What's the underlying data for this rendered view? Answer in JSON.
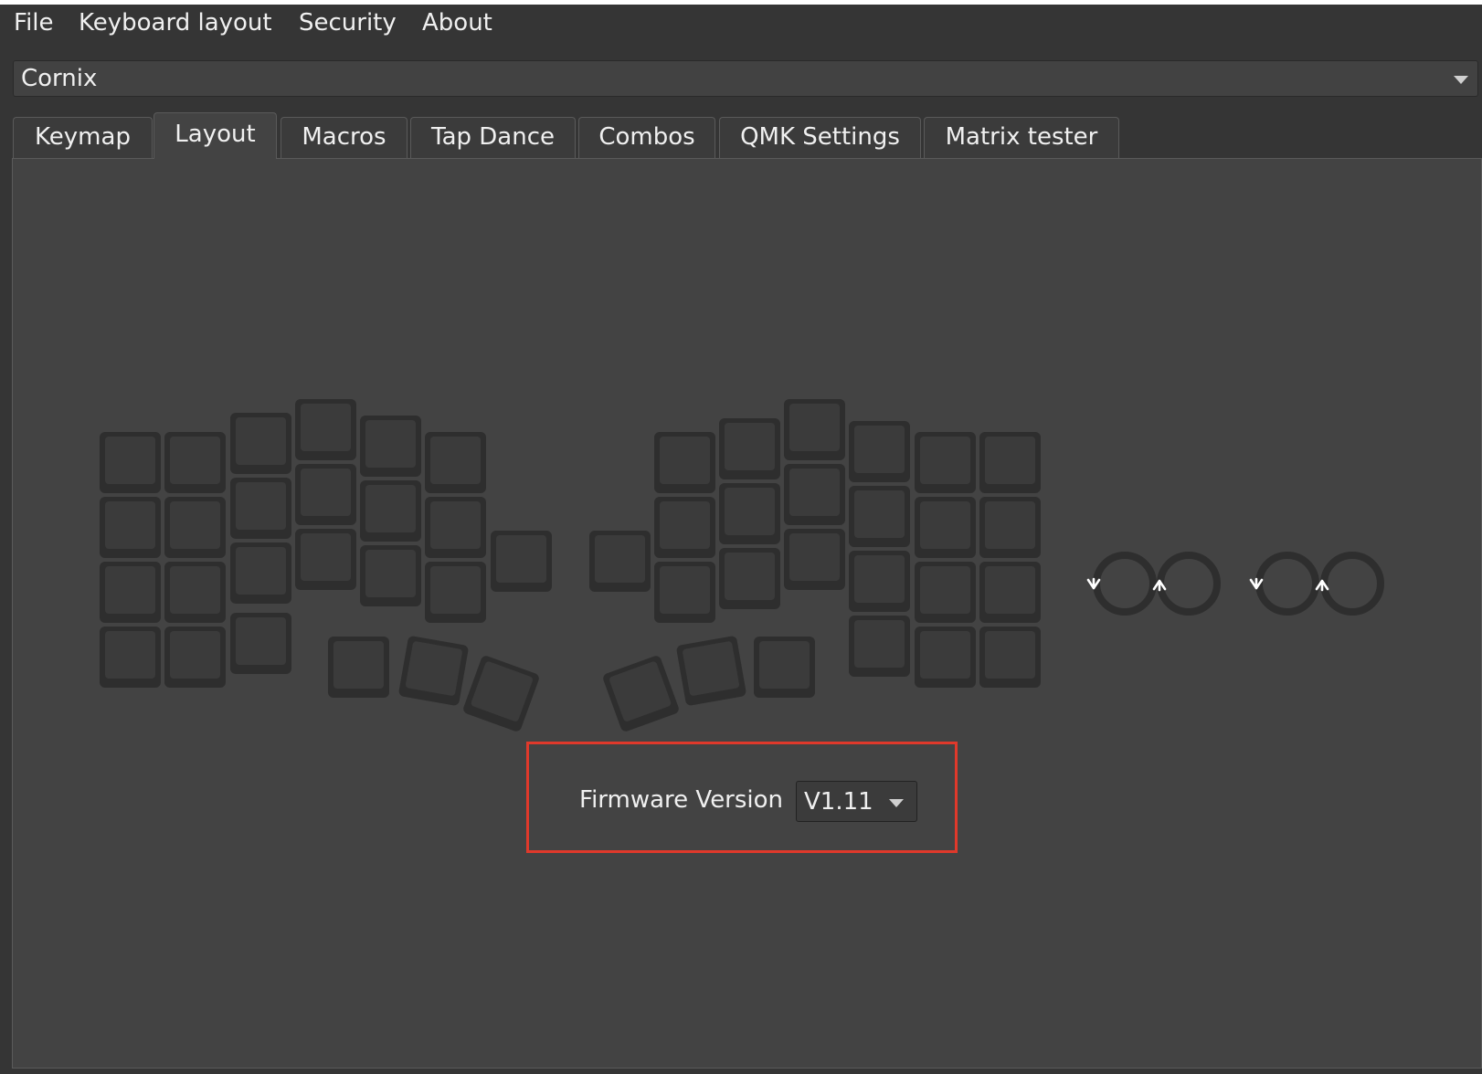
{
  "menu": {
    "items": [
      {
        "label": "File"
      },
      {
        "label": "Keyboard layout"
      },
      {
        "label": "Security"
      },
      {
        "label": "About"
      }
    ]
  },
  "device": {
    "selected": "Cornix"
  },
  "tabs": [
    {
      "label": "Keymap"
    },
    {
      "label": "Layout"
    },
    {
      "label": "Macros"
    },
    {
      "label": "Tap Dance"
    },
    {
      "label": "Combos"
    },
    {
      "label": "QMK Settings"
    },
    {
      "label": "Matrix tester"
    }
  ],
  "active_tab": "Layout",
  "firmware": {
    "label": "Firmware Version",
    "selected": "V1.11"
  },
  "colors": {
    "background": "#353535",
    "panel": "#434343",
    "key": "#2e2e2e",
    "highlight": "#e0392b"
  }
}
